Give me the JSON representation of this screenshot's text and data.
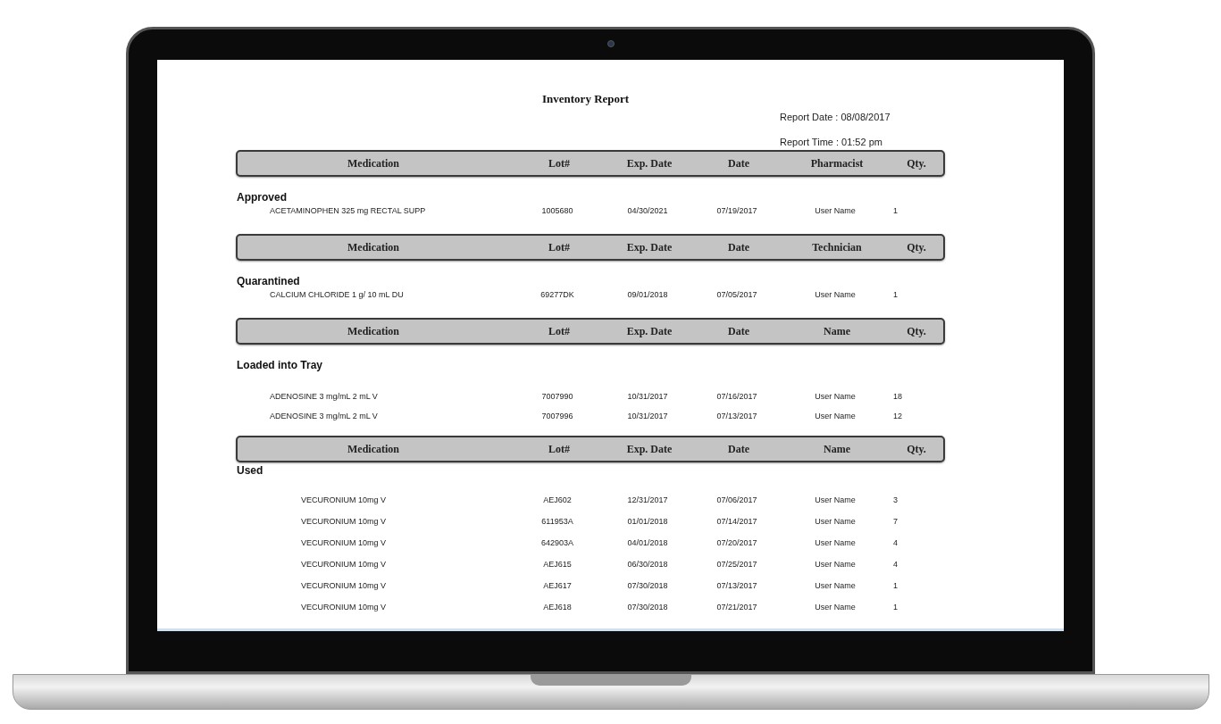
{
  "report": {
    "title": "Inventory Report",
    "report_date": "Report Date : 08/08/2017",
    "report_time": "Report Time : 01:52 pm",
    "sections": [
      {
        "columns": [
          "Medication",
          "Lot#",
          "Exp. Date",
          "Date",
          "Pharmacist",
          "Qty."
        ],
        "title": "Approved",
        "rows": [
          {
            "medication": "ACETAMINOPHEN 325 mg RECTAL SUPP",
            "lot": "1005680",
            "exp_date": "04/30/2021",
            "date": "07/19/2017",
            "name": "User Name",
            "qty": "1"
          }
        ]
      },
      {
        "columns": [
          "Medication",
          "Lot#",
          "Exp. Date",
          "Date",
          "Technician",
          "Qty."
        ],
        "title": "Quarantined",
        "rows": [
          {
            "medication": "CALCIUM CHLORIDE 1 g/ 10 mL DU",
            "lot": "69277DK",
            "exp_date": "09/01/2018",
            "date": "07/05/2017",
            "name": "User Name",
            "qty": "1"
          }
        ]
      },
      {
        "columns": [
          "Medication",
          "Lot#",
          "Exp. Date",
          "Date",
          "Name",
          "Qty."
        ],
        "title": "Loaded into Tray",
        "rows": [
          {
            "medication": "ADENOSINE 3 mg/mL 2 mL V",
            "lot": "7007990",
            "exp_date": "10/31/2017",
            "date": "07/16/2017",
            "name": "User Name",
            "qty": "18"
          },
          {
            "medication": "ADENOSINE 3 mg/mL 2 mL V",
            "lot": "7007996",
            "exp_date": "10/31/2017",
            "date": "07/13/2017",
            "name": "User Name",
            "qty": "12"
          }
        ]
      },
      {
        "columns": [
          "Medication",
          "Lot#",
          "Exp. Date",
          "Date",
          "Name",
          "Qty."
        ],
        "title": "Used",
        "rows": [
          {
            "medication": "VECURONIUM 10mg V",
            "lot": "AEJ602",
            "exp_date": "12/31/2017",
            "date": "07/06/2017",
            "name": "User Name",
            "qty": "3"
          },
          {
            "medication": "VECURONIUM 10mg V",
            "lot": "611953A",
            "exp_date": "01/01/2018",
            "date": "07/14/2017",
            "name": "User Name",
            "qty": "7"
          },
          {
            "medication": "VECURONIUM 10mg V",
            "lot": "642903A",
            "exp_date": "04/01/2018",
            "date": "07/20/2017",
            "name": "User Name",
            "qty": "4"
          },
          {
            "medication": "VECURONIUM 10mg V",
            "lot": "AEJ615",
            "exp_date": "06/30/2018",
            "date": "07/25/2017",
            "name": "User Name",
            "qty": "4"
          },
          {
            "medication": "VECURONIUM 10mg V",
            "lot": "AEJ617",
            "exp_date": "07/30/2018",
            "date": "07/13/2017",
            "name": "User Name",
            "qty": "1"
          },
          {
            "medication": "VECURONIUM 10mg V",
            "lot": "AEJ618",
            "exp_date": "07/30/2018",
            "date": "07/21/2017",
            "name": "User Name",
            "qty": "1"
          }
        ]
      }
    ]
  }
}
